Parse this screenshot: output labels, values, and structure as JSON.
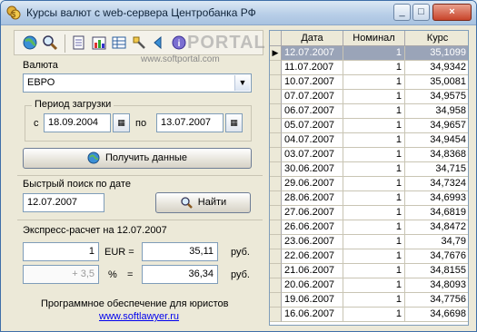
{
  "window": {
    "title": "Курсы валют с web-сервера Центробанка РФ"
  },
  "titlebar": {
    "minimize": "_",
    "maximize": "□",
    "close": "×"
  },
  "toolbar": {
    "icons": [
      "globe-icon",
      "search-icon",
      "document-icon",
      "bar-chart-icon",
      "table-icon",
      "tools-icon",
      "back-icon",
      "info-icon"
    ],
    "watermark": "PORTAL",
    "watermark_url": "www.softportal.com"
  },
  "currency": {
    "label": "Валюта",
    "value": "ЕВРО"
  },
  "period": {
    "label": "Период загрузки",
    "from_label": "с",
    "from_value": "18.09.2004",
    "to_label": "по",
    "to_value": "13.07.2007"
  },
  "fetch": {
    "label": "Получить данные"
  },
  "quick": {
    "label": "Быстрый поиск по дате",
    "date": "12.07.2007",
    "find_label": "Найти"
  },
  "express": {
    "title": "Экспресс-расчет на 12.07.2007",
    "amount": "1",
    "currency_code": "EUR =",
    "result": "35,11",
    "unit": "руб.",
    "percent": "+ 3,5",
    "percent_sign": "%",
    "eq": "=",
    "result2": "36,34",
    "unit2": "руб."
  },
  "footer": {
    "text": "Программное обеспечение для юристов",
    "link": "www.softlawyer.ru"
  },
  "grid": {
    "headers": [
      "Дата",
      "Номинал",
      "Курс"
    ],
    "rows": [
      [
        "12.07.2007",
        "1",
        "35,1099"
      ],
      [
        "11.07.2007",
        "1",
        "34,9342"
      ],
      [
        "10.07.2007",
        "1",
        "35,0081"
      ],
      [
        "07.07.2007",
        "1",
        "34,9575"
      ],
      [
        "06.07.2007",
        "1",
        "34,958"
      ],
      [
        "05.07.2007",
        "1",
        "34,9657"
      ],
      [
        "04.07.2007",
        "1",
        "34,9454"
      ],
      [
        "03.07.2007",
        "1",
        "34,8368"
      ],
      [
        "30.06.2007",
        "1",
        "34,715"
      ],
      [
        "29.06.2007",
        "1",
        "34,7324"
      ],
      [
        "28.06.2007",
        "1",
        "34,6993"
      ],
      [
        "27.06.2007",
        "1",
        "34,6819"
      ],
      [
        "26.06.2007",
        "1",
        "34,8472"
      ],
      [
        "23.06.2007",
        "1",
        "34,79"
      ],
      [
        "22.06.2007",
        "1",
        "34,7676"
      ],
      [
        "21.06.2007",
        "1",
        "34,8155"
      ],
      [
        "20.06.2007",
        "1",
        "34,8093"
      ],
      [
        "19.06.2007",
        "1",
        "34,7756"
      ],
      [
        "16.06.2007",
        "1",
        "34,6698"
      ]
    ],
    "selected_index": 0,
    "row_pointer": "▶"
  },
  "colors": {
    "selection": "#9aa4b8",
    "link": "#0000ee"
  }
}
